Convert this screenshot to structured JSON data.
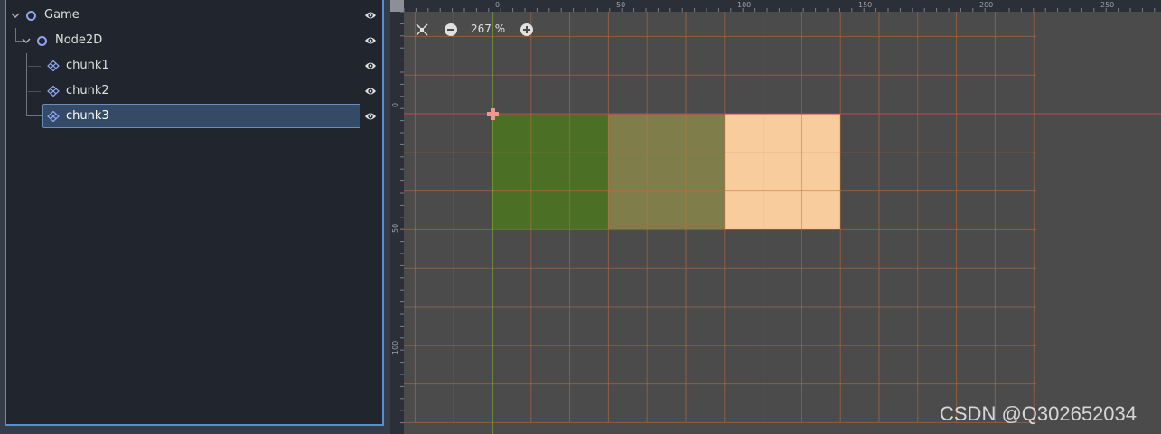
{
  "scene_tree": {
    "nodes": [
      {
        "label": "Game",
        "type": "node"
      },
      {
        "label": "Node2D",
        "type": "node2d"
      },
      {
        "label": "chunk1",
        "type": "tilemap"
      },
      {
        "label": "chunk2",
        "type": "tilemap"
      },
      {
        "label": "chunk3",
        "type": "tilemap",
        "selected": true
      }
    ]
  },
  "viewport": {
    "zoom_label": "267 %",
    "ruler_top_labels": [
      "0",
      "50",
      "100",
      "150",
      "200",
      "250"
    ],
    "ruler_left_labels": [
      "0",
      "50",
      "100"
    ],
    "tiles": [
      {
        "name": "chunk1",
        "color": "#4b7025"
      },
      {
        "name": "chunk2",
        "color": "#7f7e4b"
      },
      {
        "name": "chunk3",
        "color": "#f9cc9e"
      }
    ],
    "grid_color": "#c2703b",
    "x_axis_color": "#cc3b5b",
    "y_axis_color": "#8fbf3a"
  },
  "watermark": "CSDN @Q302652034",
  "icons": {
    "eye": "visibility-eye-icon",
    "node": "circle-node-icon",
    "tilemap": "tilemap-icon",
    "zoom_center": "center-view-icon",
    "zoom_out": "zoom-out-icon",
    "zoom_in": "zoom-in-icon"
  }
}
